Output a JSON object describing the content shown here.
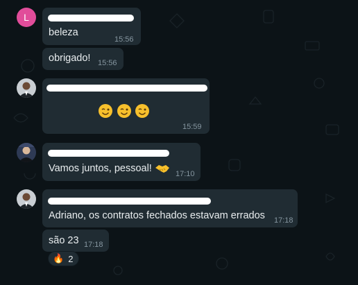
{
  "messages": [
    {
      "avatar_letter": "L",
      "text": "beleza",
      "time": "15:56"
    },
    {
      "text": "obrigado!",
      "time": "15:56"
    },
    {
      "time": "15:59"
    },
    {
      "text": "Vamos juntos, pessoal!",
      "time": "17:10"
    },
    {
      "text": "Adriano, os contratos fechados estavam errados",
      "time": "17:18"
    },
    {
      "text": "são 23",
      "time": "17:18"
    }
  ],
  "reaction": {
    "emoji": "🔥",
    "count": "2"
  },
  "colors": {
    "bubble": "#202c33",
    "background": "#0c1317",
    "timestamp": "#8696a0",
    "avatar_letter_bg": "#e14d9a"
  },
  "icons": [
    "winking-face-emoji",
    "handshake-emoji",
    "fire-emoji"
  ]
}
